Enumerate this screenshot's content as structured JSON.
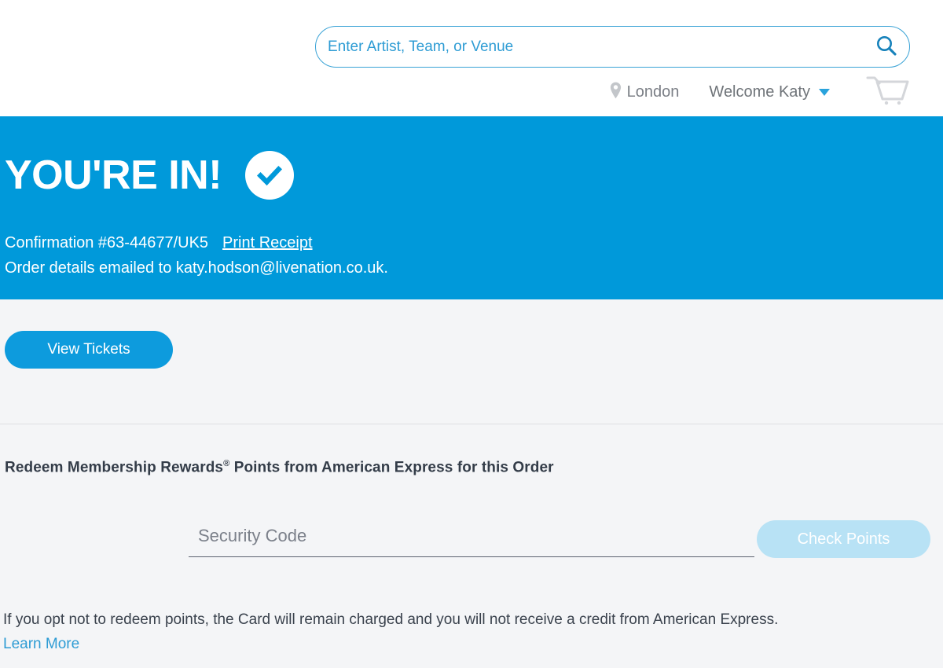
{
  "colors": {
    "brand_blue": "#0099da",
    "link_blue": "#2e9cd4",
    "button_blue": "#0d9bdd",
    "disabled_blue": "#b8e2f5",
    "page_bg": "#f4f5f7",
    "text_dark": "#333c48",
    "text_gray": "#7b7f86"
  },
  "header": {
    "search": {
      "placeholder": "Enter Artist, Team, or Venue",
      "value": "",
      "icon": "search-icon"
    },
    "location": {
      "icon": "map-pin-icon",
      "label": "London"
    },
    "account": {
      "label": "Welcome Katy",
      "icon": "chevron-down-icon"
    },
    "cart": {
      "icon": "shopping-cart-icon"
    }
  },
  "banner": {
    "title": "YOU'RE IN!",
    "badge_icon": "check-circle-icon",
    "confirmation_label": "Confirmation #63-44677/UK5",
    "print_receipt_label": "Print Receipt",
    "email_line": "Order details emailed to katy.hodson@livenation.co.uk."
  },
  "main": {
    "view_tickets_label": "View Tickets",
    "rewards": {
      "heading_before": "Redeem Membership Rewards",
      "heading_sup": "®",
      "heading_after": " Points from American Express for this Order",
      "security_code_placeholder": "Security Code",
      "security_code_value": "",
      "check_points_label": "Check Points"
    },
    "disclaimer": "If you opt not to redeem points, the Card will remain charged and you will not receive a credit from American Express.",
    "learn_more_label": "Learn More"
  }
}
